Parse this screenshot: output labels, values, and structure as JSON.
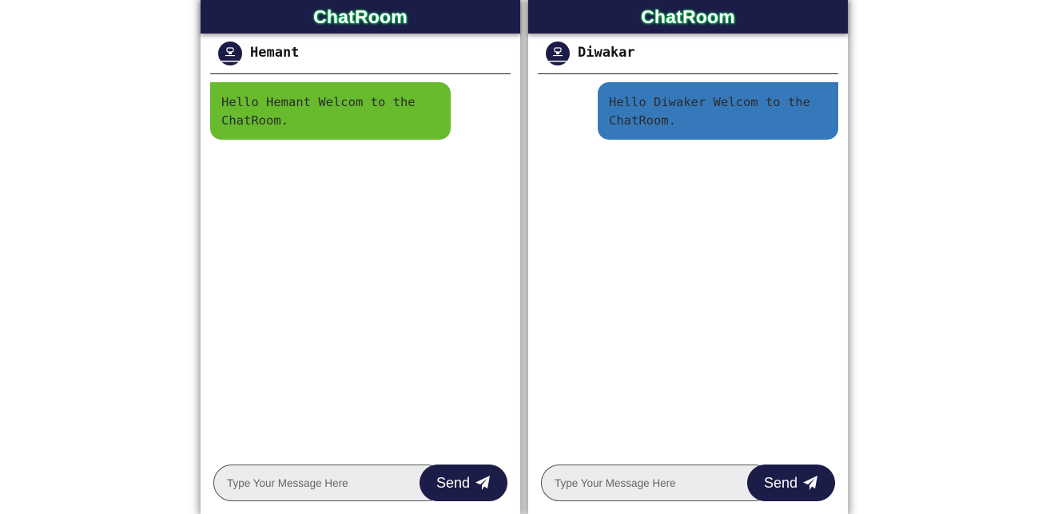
{
  "colors": {
    "header_bg": "#1c1c48",
    "title_glow": "#16c25a",
    "incoming_bubble": "#67bb2d",
    "outgoing_bubble": "#3679bb",
    "input_bg": "#ececef",
    "send_button": "#1c1c48"
  },
  "panels": [
    {
      "title": "ChatRoom",
      "user": {
        "name": "Hemant",
        "avatar_icon": "user-avatar-icon"
      },
      "messages": [
        {
          "text": "Hello Hemant Welcom to the ChatRoom.",
          "direction": "incoming"
        }
      ],
      "composer": {
        "placeholder": "Type Your Message Here",
        "send_label": "Send",
        "send_icon": "paper-plane-icon"
      }
    },
    {
      "title": "ChatRoom",
      "user": {
        "name": "Diwakar",
        "avatar_icon": "user-avatar-icon"
      },
      "messages": [
        {
          "text": "Hello Diwaker Welcom to the ChatRoom.",
          "direction": "outgoing"
        }
      ],
      "composer": {
        "placeholder": "Type Your Message Here",
        "send_label": "Send",
        "send_icon": "paper-plane-icon"
      }
    }
  ]
}
